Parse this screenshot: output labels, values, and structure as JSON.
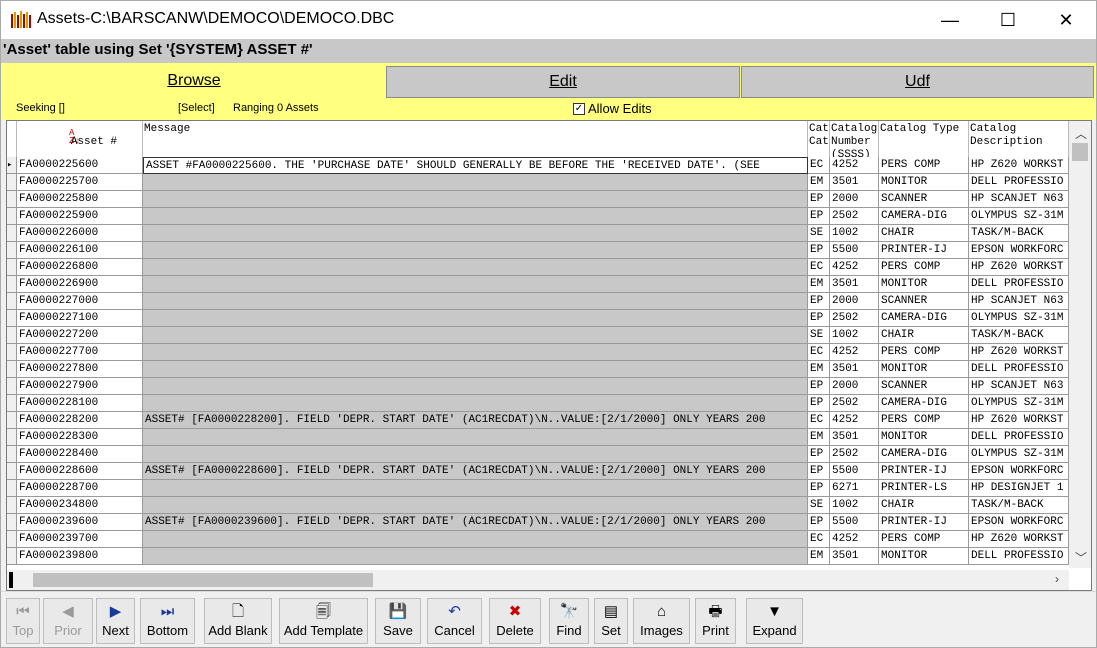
{
  "window": {
    "title": "Assets-C:\\BARSCANW\\DEMOCO\\DEMOCO.DBC",
    "minimize": "—",
    "maximize": "☐",
    "close": "✕"
  },
  "caption": "'Asset' table using Set '{SYSTEM} ASSET #'",
  "tabs": {
    "browse": "Browse",
    "edit": "Edit",
    "udf": "Udf"
  },
  "strip": {
    "seeking": "Seeking  []",
    "select": "[Select]",
    "ranging": "Ranging  0 Assets",
    "allow_edits": "Allow Edits",
    "allow_checked": true
  },
  "grid": {
    "headers": {
      "asset": "Asset #",
      "sort_icon": "AZ",
      "message": "Message",
      "cat": "Cat\nCat",
      "catnum": "Catalog\nNumber\n(SSSS)",
      "cattype": "Catalog Type",
      "catdesc": "Catalog\nDescription"
    },
    "rows": [
      {
        "asset": "FA0000225600",
        "msg": "ASSET #FA0000225600. THE 'PURCHASE DATE' SHOULD GENERALLY BE BEFORE THE 'RECEIVED DATE'. (SEE",
        "cat": "EC",
        "num": "4252",
        "type": "PERS COMP",
        "desc": "HP Z620 WORKST"
      },
      {
        "asset": "FA0000225700",
        "msg": "",
        "cat": "EM",
        "num": "3501",
        "type": "MONITOR",
        "desc": "DELL PROFESSIO"
      },
      {
        "asset": "FA0000225800",
        "msg": "",
        "cat": "EP",
        "num": "2000",
        "type": "SCANNER",
        "desc": "HP SCANJET N63"
      },
      {
        "asset": "FA0000225900",
        "msg": "",
        "cat": "EP",
        "num": "2502",
        "type": "CAMERA-DIG",
        "desc": "OLYMPUS SZ-31M"
      },
      {
        "asset": "FA0000226000",
        "msg": "",
        "cat": "SE",
        "num": "1002",
        "type": "CHAIR",
        "desc": "TASK/M-BACK"
      },
      {
        "asset": "FA0000226100",
        "msg": "",
        "cat": "EP",
        "num": "5500",
        "type": "PRINTER-IJ",
        "desc": "EPSON WORKFORC"
      },
      {
        "asset": "FA0000226800",
        "msg": "",
        "cat": "EC",
        "num": "4252",
        "type": "PERS COMP",
        "desc": "HP Z620 WORKST"
      },
      {
        "asset": "FA0000226900",
        "msg": "",
        "cat": "EM",
        "num": "3501",
        "type": "MONITOR",
        "desc": "DELL PROFESSIO"
      },
      {
        "asset": "FA0000227000",
        "msg": "",
        "cat": "EP",
        "num": "2000",
        "type": "SCANNER",
        "desc": "HP SCANJET N63"
      },
      {
        "asset": "FA0000227100",
        "msg": "",
        "cat": "EP",
        "num": "2502",
        "type": "CAMERA-DIG",
        "desc": "OLYMPUS SZ-31M"
      },
      {
        "asset": "FA0000227200",
        "msg": "",
        "cat": "SE",
        "num": "1002",
        "type": "CHAIR",
        "desc": "TASK/M-BACK"
      },
      {
        "asset": "FA0000227700",
        "msg": "",
        "cat": "EC",
        "num": "4252",
        "type": "PERS COMP",
        "desc": "HP Z620 WORKST"
      },
      {
        "asset": "FA0000227800",
        "msg": "",
        "cat": "EM",
        "num": "3501",
        "type": "MONITOR",
        "desc": "DELL PROFESSIO"
      },
      {
        "asset": "FA0000227900",
        "msg": "",
        "cat": "EP",
        "num": "2000",
        "type": "SCANNER",
        "desc": "HP SCANJET N63"
      },
      {
        "asset": "FA0000228100",
        "msg": "",
        "cat": "EP",
        "num": "2502",
        "type": "CAMERA-DIG",
        "desc": "OLYMPUS SZ-31M"
      },
      {
        "asset": "FA0000228200",
        "msg": "ASSET# [FA0000228200]. FIELD 'DEPR. START DATE' (AC1RECDAT)\\N..VALUE:[2/1/2000] ONLY YEARS 200",
        "cat": "EC",
        "num": "4252",
        "type": "PERS COMP",
        "desc": "HP Z620 WORKST"
      },
      {
        "asset": "FA0000228300",
        "msg": "",
        "cat": "EM",
        "num": "3501",
        "type": "MONITOR",
        "desc": "DELL PROFESSIO"
      },
      {
        "asset": "FA0000228400",
        "msg": "",
        "cat": "EP",
        "num": "2502",
        "type": "CAMERA-DIG",
        "desc": "OLYMPUS SZ-31M"
      },
      {
        "asset": "FA0000228600",
        "msg": "ASSET# [FA0000228600]. FIELD 'DEPR. START DATE' (AC1RECDAT)\\N..VALUE:[2/1/2000] ONLY YEARS 200",
        "cat": "EP",
        "num": "5500",
        "type": "PRINTER-IJ",
        "desc": "EPSON WORKFORC"
      },
      {
        "asset": "FA0000228700",
        "msg": "",
        "cat": "EP",
        "num": "6271",
        "type": "PRINTER-LS",
        "desc": "HP DESIGNJET 1"
      },
      {
        "asset": "FA0000234800",
        "msg": "",
        "cat": "SE",
        "num": "1002",
        "type": "CHAIR",
        "desc": "TASK/M-BACK"
      },
      {
        "asset": "FA0000239600",
        "msg": "ASSET# [FA0000239600]. FIELD 'DEPR. START DATE' (AC1RECDAT)\\N..VALUE:[2/1/2000] ONLY YEARS 200",
        "cat": "EP",
        "num": "5500",
        "type": "PRINTER-IJ",
        "desc": "EPSON WORKFORC"
      },
      {
        "asset": "FA0000239700",
        "msg": "",
        "cat": "EC",
        "num": "4252",
        "type": "PERS COMP",
        "desc": "HP Z620 WORKST"
      },
      {
        "asset": "FA0000239800",
        "msg": "",
        "cat": "EM",
        "num": "3501",
        "type": "MONITOR",
        "desc": "DELL PROFESSIO"
      }
    ]
  },
  "toolbar": {
    "buttons": [
      {
        "name": "top",
        "label": "Top",
        "icon": "⏮",
        "disabled": true
      },
      {
        "name": "prior",
        "label": "Prior",
        "icon": "◀",
        "disabled": true
      },
      {
        "name": "next",
        "label": "Next",
        "icon": "▶",
        "disabled": false
      },
      {
        "name": "bottom",
        "label": "Bottom",
        "icon": "⏭",
        "disabled": false
      },
      {
        "name": "add-blank",
        "label": "Add Blank",
        "icon": "🗋",
        "disabled": false
      },
      {
        "name": "add-template",
        "label": "Add Template",
        "icon": "🗐",
        "disabled": false
      },
      {
        "name": "save",
        "label": "Save",
        "icon": "💾",
        "disabled": false
      },
      {
        "name": "cancel",
        "label": "Cancel",
        "icon": "↶",
        "disabled": false
      },
      {
        "name": "delete",
        "label": "Delete",
        "icon": "✖",
        "disabled": false
      },
      {
        "name": "find",
        "label": "Find",
        "icon": "🔭",
        "disabled": false
      },
      {
        "name": "set",
        "label": "Set",
        "icon": "▤",
        "disabled": false
      },
      {
        "name": "images",
        "label": "Images",
        "icon": "⌂",
        "disabled": false
      },
      {
        "name": "print",
        "label": "Print",
        "icon": "🖶",
        "disabled": false
      },
      {
        "name": "expand",
        "label": "Expand",
        "icon": "▼",
        "disabled": false
      }
    ]
  },
  "colors": {
    "accent": "#ffff80",
    "gray": "#c8c8c8",
    "delete_red": "#cc0000",
    "nav_blue": "#1a3a9a"
  }
}
